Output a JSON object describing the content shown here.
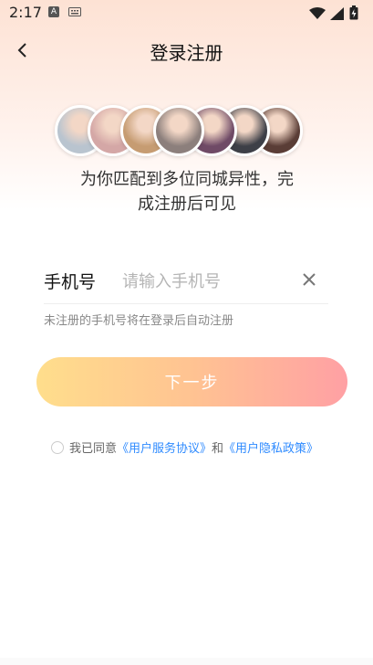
{
  "status_bar": {
    "time": "2:17",
    "app_badge": "A",
    "icons": [
      "keyboard-icon",
      "wifi-icon",
      "signal-icon",
      "battery-charging-icon"
    ]
  },
  "header": {
    "back_icon": "chevron-left-icon",
    "title": "登录注册"
  },
  "avatars": [
    {
      "color": "#b9c4cf"
    },
    {
      "color": "#d4a7a6"
    },
    {
      "color": "#c69c72"
    },
    {
      "color": "#8c7f7c"
    },
    {
      "color": "#6f4a66"
    },
    {
      "color": "#3d3f47"
    },
    {
      "color": "#5a3d36"
    }
  ],
  "promo": {
    "line1": "为你匹配到多位同城异性，完",
    "line2": "成注册后可见"
  },
  "phone_form": {
    "label": "手机号",
    "placeholder": "请输入手机号",
    "value": "",
    "clear_icon": "close-icon",
    "hint": "未注册的手机号将在登录后自动注册"
  },
  "next_button": {
    "label": "下一步",
    "gradient": [
      "#ffde8c",
      "#ffa0a4"
    ]
  },
  "agreement": {
    "prefix": "我已同意",
    "terms_link": "《用户服务协议》",
    "conjunction": "和",
    "privacy_link": "《用户隐私政策》",
    "link_color": "#2f8bff"
  }
}
